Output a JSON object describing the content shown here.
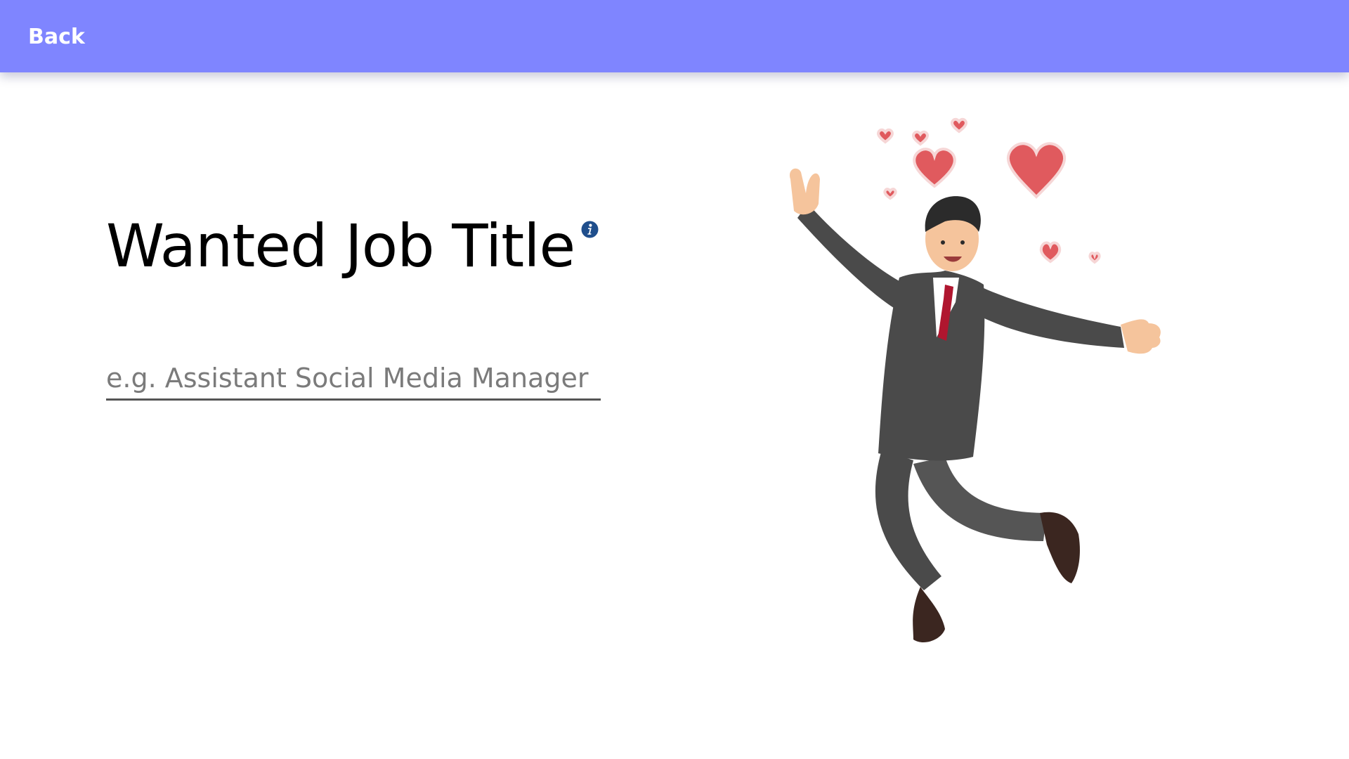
{
  "header": {
    "back_label": "Back",
    "background_color": "#7f85ff"
  },
  "form": {
    "title": "Wanted Job Title",
    "info_icon": "info-icon",
    "job_title_input": {
      "value": "",
      "placeholder": "e.g. Assistant Social Media Manager"
    }
  },
  "illustration": {
    "subject": "jumping-businessman-with-hearts",
    "colors": {
      "suit": "#4a4a4a",
      "tie": "#b0162f",
      "hearts": "#e05a5e",
      "skin": "#f5c49c"
    }
  }
}
